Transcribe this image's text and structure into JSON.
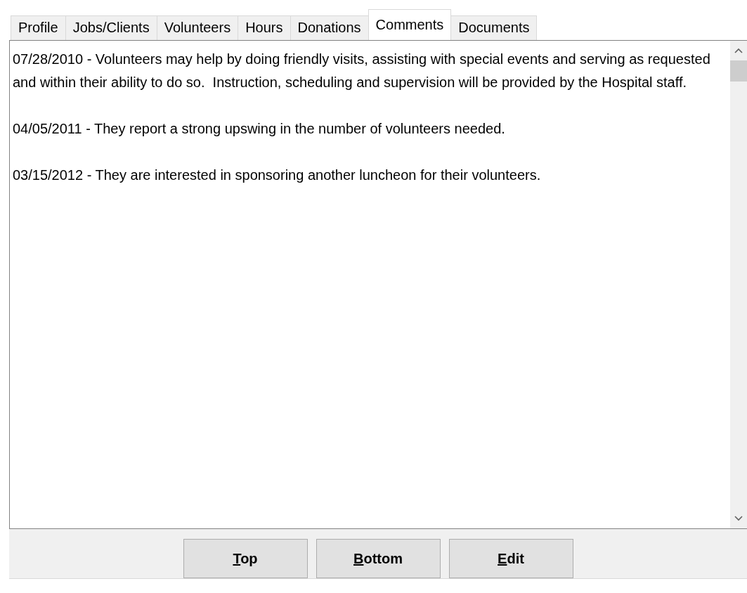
{
  "tabs": [
    {
      "label": "Profile",
      "selected": false
    },
    {
      "label": "Jobs/Clients",
      "selected": false
    },
    {
      "label": "Volunteers",
      "selected": false
    },
    {
      "label": "Hours",
      "selected": false
    },
    {
      "label": "Donations",
      "selected": false
    },
    {
      "label": "Comments",
      "selected": true
    },
    {
      "label": "Documents",
      "selected": false
    }
  ],
  "comments": [
    "07/28/2010 - Volunteers may help by doing friendly visits, assisting with special events and serving as requested and within their ability to do so.  Instruction, scheduling and supervision will be provided by the Hospital staff.",
    "04/05/2011 - They report a strong upswing in the number of volunteers needed.",
    "03/15/2012 - They are interested in sponsoring another luncheon for their volunteers."
  ],
  "buttons": [
    "Top",
    "Bottom",
    "Edit"
  ]
}
